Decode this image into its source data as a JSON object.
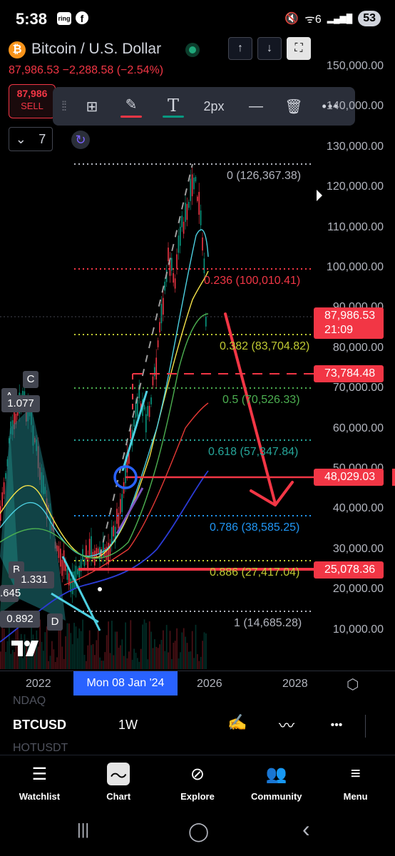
{
  "status_bar": {
    "time": "5:38",
    "ring_badge": "ring",
    "facebook_glyph": "f",
    "mute_glyph": "🔇",
    "wifi_glyph": "ᯤ6",
    "signal_glyph": "▂▄▆█",
    "battery": "53"
  },
  "header": {
    "logo_glyph": "₿",
    "title": "Bitcoin / U.S. Dollar",
    "price_change": "87,986.53  −2,288.58 (−2.54%)",
    "up_glyph": "↑",
    "down_glyph": "↓",
    "fullscreen_glyph": "⛶",
    "sell_price": "87,986",
    "sell_label": "SELL",
    "interval_value": "7",
    "interval_chevron": "⌄",
    "sync_glyph": "↻"
  },
  "draw_toolbar": {
    "grip_glyph": "⁞⁞",
    "add_glyph": "⊞",
    "pencil_glyph": "✎",
    "pencil_color": "#f23645",
    "text_glyph": "T",
    "text_color": "#089981",
    "stroke_width": "2px",
    "line_glyph": "—",
    "trash_glyph": "🗑",
    "more_glyph": "•••"
  },
  "price_scale": [
    "150,000.00",
    "140,000.00",
    "130,000.00",
    "120,000.00",
    "110,000.00",
    "100,000.00",
    "90,000.00",
    "80,000.00",
    "70,000.00",
    "60,000.00",
    "50,000.00",
    "40,000.00",
    "30,000.00",
    "20,000.00",
    "10,000.00"
  ],
  "price_tags": {
    "current_price": "87,986.53",
    "countdown": "21:09",
    "level_1": "73,784.48",
    "level_2": "48,029.03",
    "level_3": "25,078.36"
  },
  "fib_levels": [
    {
      "label": "0 (126,367.38)",
      "color": "#b2b5be"
    },
    {
      "label": "0.236 (100,010.41)",
      "color": "#f23645"
    },
    {
      "label": "0.382 (83,704.82)",
      "color": "#c0ca33"
    },
    {
      "label": "0.5 (70,526.33)",
      "color": "#4caf50"
    },
    {
      "label": "0.618 (57,347.84)",
      "color": "#26a69a"
    },
    {
      "label": "0.786 (38,585.25)",
      "color": "#2196f3"
    },
    {
      "label": "0.886 (27,417.04)",
      "color": "#c0ca33"
    },
    {
      "label": "1 (14,685.28)",
      "color": "#b2b5be"
    }
  ],
  "pattern_labels": {
    "a": "A",
    "c": "C",
    "ratio_c": "1.077",
    "b": "B",
    "ratio_b": "1.331",
    "left_value": ".645",
    "ratio_d": "0.892",
    "d": "D"
  },
  "time_axis": {
    "label_2022": "2022",
    "cursor": "Mon 08 Jan '24",
    "label_2026": "2026",
    "label_2028": "2028",
    "settings_glyph": "⬡"
  },
  "symbol_row": {
    "ghost_top": "NDAQ",
    "symbol": "BTCUSD",
    "interval": "1W",
    "ghost_bottom": "HOTUSDT",
    "draw_glyph": "✍",
    "indicators_glyph": "〰",
    "more_glyph": "•••"
  },
  "bottom_nav": [
    {
      "label": "Watchlist",
      "icon": "list-icon",
      "glyph": "☰"
    },
    {
      "label": "Chart",
      "icon": "chart-icon",
      "glyph": "〜"
    },
    {
      "label": "Explore",
      "icon": "compass-icon",
      "glyph": "⊘"
    },
    {
      "label": "Community",
      "icon": "people-icon",
      "glyph": "👥"
    },
    {
      "label": "Menu",
      "icon": "menu-icon",
      "glyph": "≡"
    }
  ],
  "android_nav": {
    "recents": "|||",
    "home": "◯",
    "back": "‹"
  },
  "colors": {
    "accent": "#2962ff",
    "down": "#f23645",
    "up": "#089981"
  }
}
